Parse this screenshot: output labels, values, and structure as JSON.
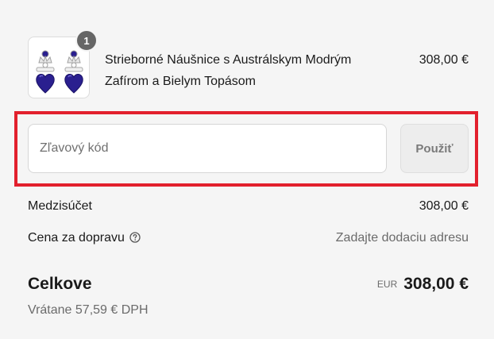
{
  "product": {
    "name_line1": "Strieborné Náušnice s Austrálskym Modrým",
    "name_line2": "Zafírom a Bielym Topásom",
    "price": "308,00 €",
    "quantity": "1",
    "image_icon": "earrings-product-image"
  },
  "discount": {
    "placeholder": "Zľavový kód",
    "value": "",
    "apply_label": "Použiť",
    "highlight_color": "#e2202d"
  },
  "summary": {
    "subtotal_label": "Medzisúčet",
    "subtotal_value": "308,00 €",
    "shipping_label": "Cena za dopravu",
    "shipping_help_icon": "question-circle-icon",
    "shipping_value": "Zadajte dodaciu adresu",
    "total_label": "Celkove",
    "total_currency": "EUR",
    "total_value": "308,00 €",
    "tax_note": "Vrátane 57,59 € DPH"
  },
  "colors": {
    "background": "#f5f5f5",
    "badge": "#666666",
    "jewel": "#2a1f8f",
    "muted_text": "#6b6b6b"
  }
}
